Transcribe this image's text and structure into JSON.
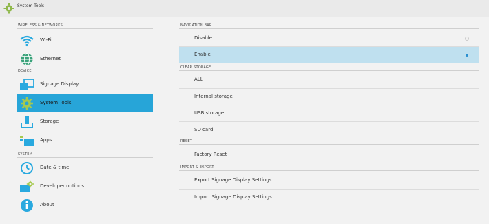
{
  "window": {
    "title": "System Tools"
  },
  "sidebar": {
    "sections": [
      {
        "header": "WIRELESS & NETWORKS"
      },
      {
        "header": "DEVICE"
      },
      {
        "header": "SYSTEM"
      }
    ],
    "items": [
      {
        "label": "Wi-Fi",
        "icon": "wifi-icon"
      },
      {
        "label": "Ethernet",
        "icon": "globe-icon"
      },
      {
        "label": "Signage Display",
        "icon": "display-icon"
      },
      {
        "label": "System Tools",
        "icon": "gear-icon",
        "selected": true
      },
      {
        "label": "Storage",
        "icon": "storage-icon"
      },
      {
        "label": "Apps",
        "icon": "apps-icon"
      },
      {
        "label": "Date & time",
        "icon": "clock-icon"
      },
      {
        "label": "Developer options",
        "icon": "developer-icon"
      },
      {
        "label": "About",
        "icon": "info-icon"
      }
    ]
  },
  "main": {
    "sections": [
      {
        "header": "NAVIGATION BAR"
      },
      {
        "header": "CLEAR STORAGE"
      },
      {
        "header": "RESET"
      },
      {
        "header": "IMPORT & EXPORT"
      }
    ],
    "navigation_bar": {
      "options": [
        {
          "label": "Disable",
          "selected": false
        },
        {
          "label": "Enable",
          "selected": true
        }
      ]
    },
    "clear_storage": [
      "ALL",
      "Internal storage",
      "USB storage",
      "SD card"
    ],
    "reset": [
      "Factory Reset"
    ],
    "import_export": [
      "Export Signage Display Settings",
      "Import Signage Display Settings"
    ]
  },
  "colors": {
    "selected_nav": "#27a5d8",
    "selected_row": "#bfe0ef",
    "radio_on": "#2a8fd0"
  }
}
